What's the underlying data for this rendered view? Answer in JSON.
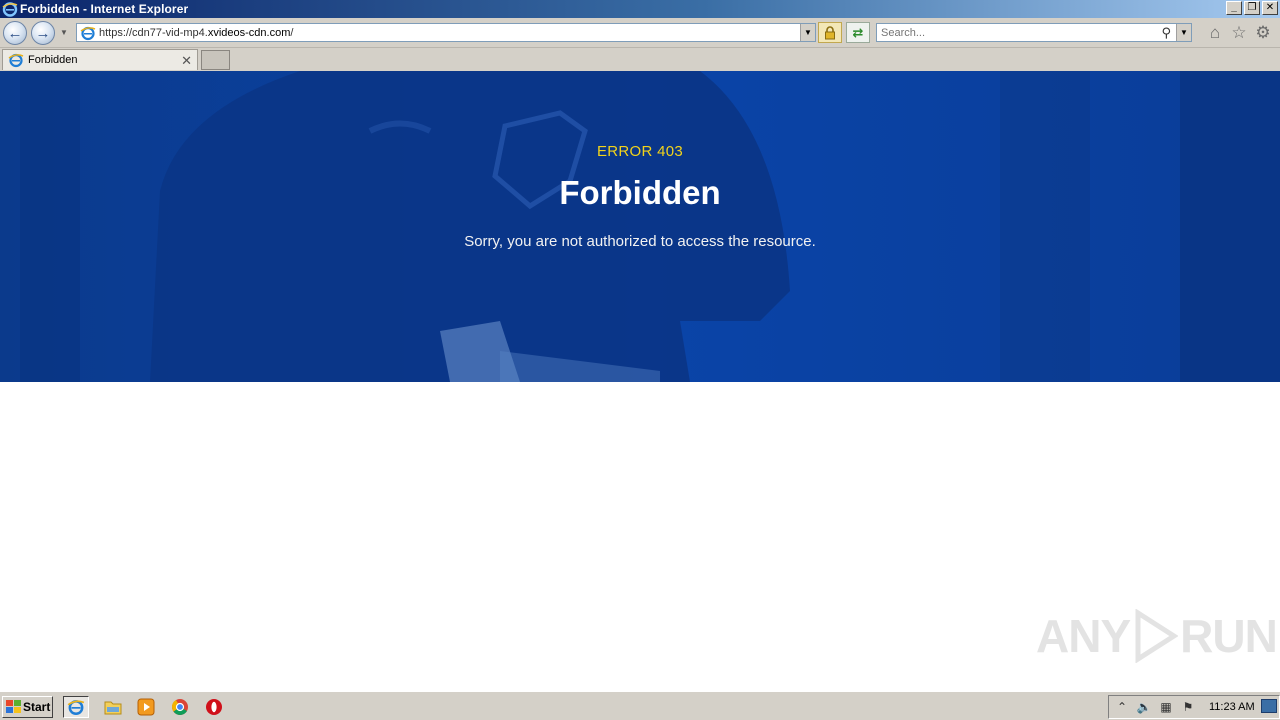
{
  "window": {
    "title": "Forbidden - Internet Explorer",
    "controls": {
      "minimize": "_",
      "restore": "❐",
      "close": "✕"
    }
  },
  "address_bar": {
    "url_prefix": "https://cdn77-vid-mp4.",
    "url_host": "xvideos-cdn.com",
    "url_suffix": "/",
    "back_icon": "back-arrow-icon",
    "forward_icon": "forward-arrow-icon"
  },
  "search": {
    "placeholder": "Search..."
  },
  "tabs": [
    {
      "label": "Forbidden"
    }
  ],
  "page": {
    "error_code": "ERROR 403",
    "title": "Forbidden",
    "message": "Sorry, you are not authorized to access the resource."
  },
  "watermark": {
    "left": "ANY",
    "right": "RUN"
  },
  "taskbar": {
    "start_label": "Start",
    "clock": "11:23 AM"
  },
  "colors": {
    "hero_bg": "#0a3d98",
    "error_code": "#f2d31b",
    "title_text": "#ffffff"
  }
}
